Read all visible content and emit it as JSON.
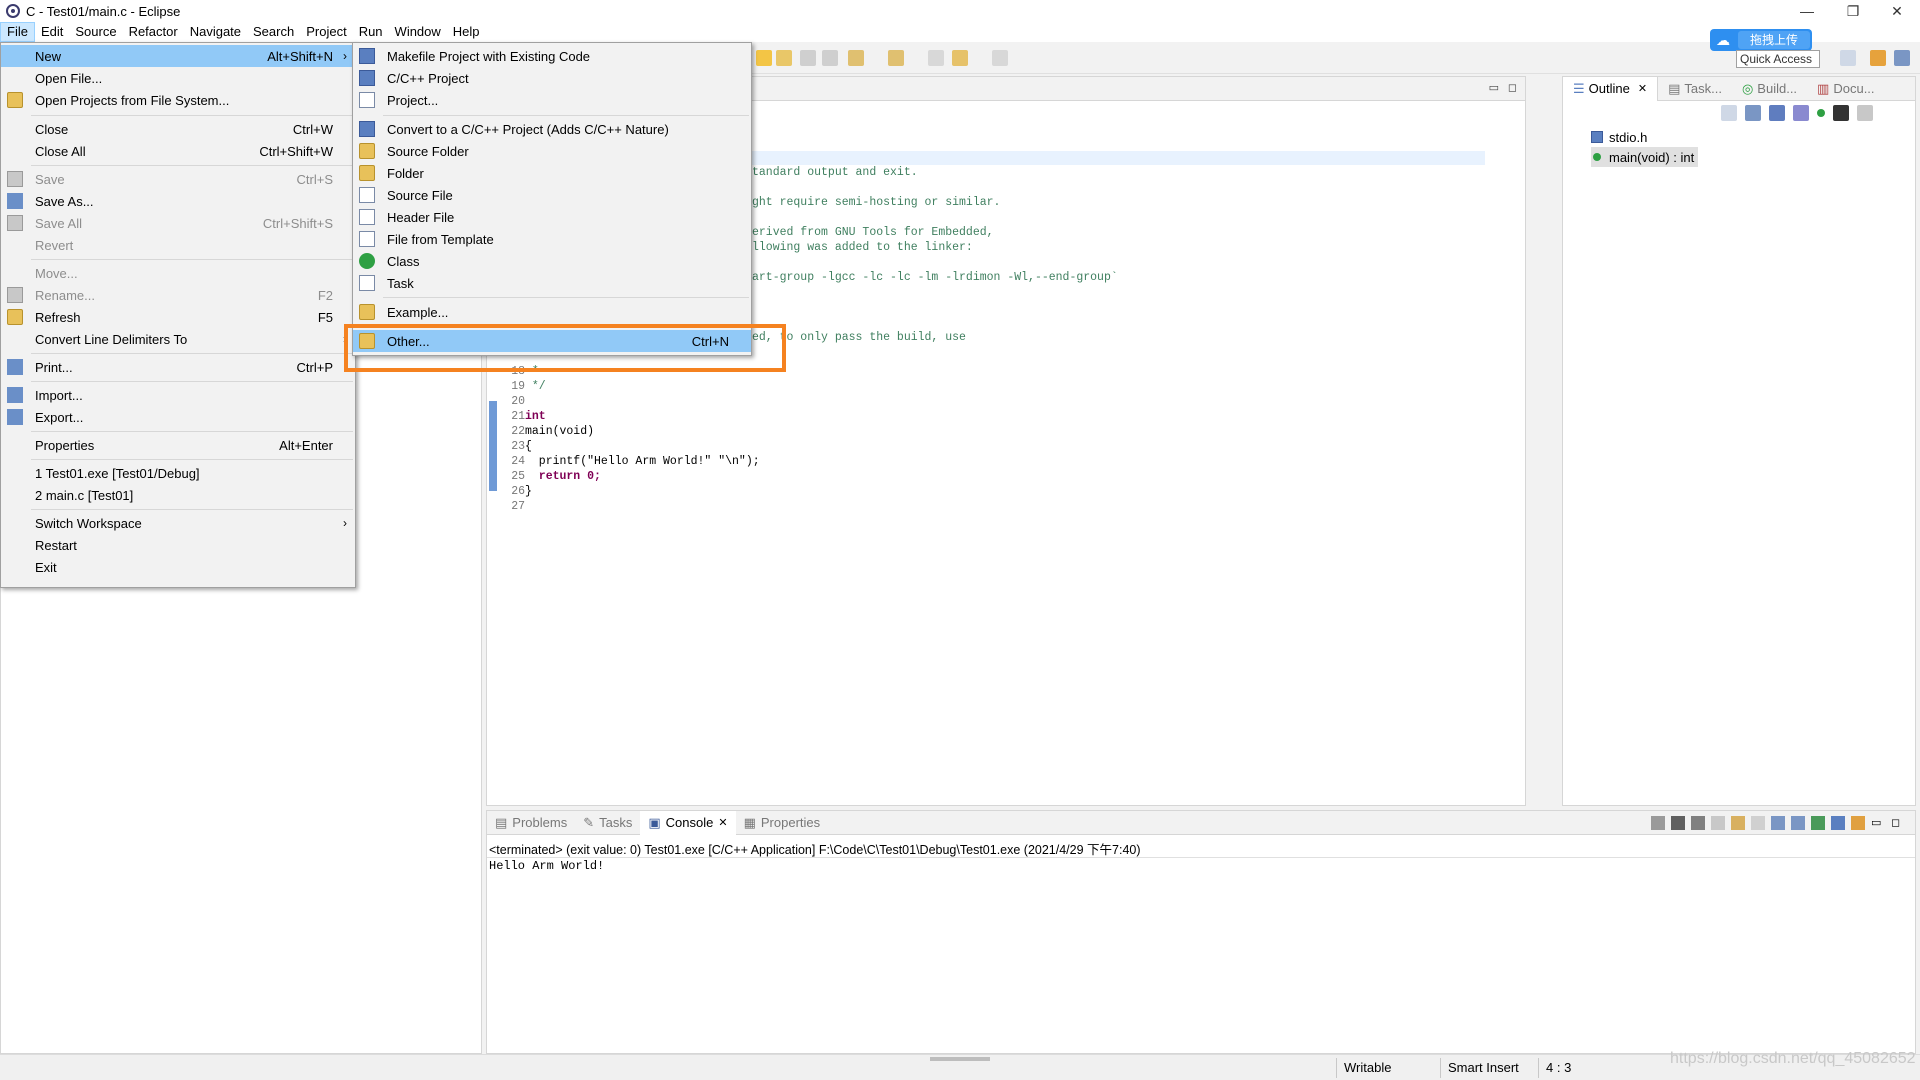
{
  "window": {
    "title": "C - Test01/main.c - Eclipse",
    "controls": [
      "—",
      "❐",
      "✕"
    ]
  },
  "menubar": [
    "File",
    "Edit",
    "Source",
    "Refactor",
    "Navigate",
    "Search",
    "Project",
    "Run",
    "Window",
    "Help"
  ],
  "toolbar": {
    "quick_access": "Quick Access",
    "upload_badge": "拖拽上传"
  },
  "file_menu": [
    {
      "label": "New",
      "accel": "Alt+Shift+N",
      "submenu": true,
      "highlighted": true
    },
    {
      "label": "Open File...",
      "accel": ""
    },
    {
      "label": "Open Projects from File System...",
      "accel": ""
    },
    {
      "label": "Close",
      "accel": "Ctrl+W"
    },
    {
      "label": "Close All",
      "accel": "Ctrl+Shift+W"
    },
    {
      "label": "Save",
      "accel": "Ctrl+S",
      "disabled": true
    },
    {
      "label": "Save As...",
      "accel": ""
    },
    {
      "label": "Save All",
      "accel": "Ctrl+Shift+S",
      "disabled": true
    },
    {
      "label": "Revert",
      "accel": "",
      "disabled": true
    },
    {
      "label": "Move...",
      "accel": "",
      "disabled": true
    },
    {
      "label": "Rename...",
      "accel": "F2",
      "disabled": true
    },
    {
      "label": "Refresh",
      "accel": "F5"
    },
    {
      "label": "Convert Line Delimiters To",
      "accel": "",
      "submenu": true
    },
    {
      "label": "Print...",
      "accel": "Ctrl+P"
    },
    {
      "label": "Import...",
      "accel": ""
    },
    {
      "label": "Export...",
      "accel": ""
    },
    {
      "label": "Properties",
      "accel": "Alt+Enter"
    },
    {
      "label": "1 Test01.exe  [Test01/Debug]",
      "accel": ""
    },
    {
      "label": "2 main.c  [Test01]",
      "accel": ""
    },
    {
      "label": "Switch Workspace",
      "accel": "",
      "submenu": true
    },
    {
      "label": "Restart",
      "accel": ""
    },
    {
      "label": "Exit",
      "accel": ""
    }
  ],
  "new_submenu": [
    {
      "label": "Makefile Project with Existing Code",
      "icon": "makefile-project-icon"
    },
    {
      "label": "C/C++ Project",
      "icon": "c-project-icon"
    },
    {
      "label": "Project...",
      "icon": "project-icon"
    },
    {
      "label": "Convert to a C/C++ Project (Adds C/C++ Nature)",
      "icon": "convert-icon"
    },
    {
      "label": "Source Folder",
      "icon": "source-folder-icon"
    },
    {
      "label": "Folder",
      "icon": "folder-icon"
    },
    {
      "label": "Source File",
      "icon": "source-file-icon"
    },
    {
      "label": "Header File",
      "icon": "header-file-icon"
    },
    {
      "label": "File from Template",
      "icon": "template-file-icon"
    },
    {
      "label": "Class",
      "icon": "class-icon"
    },
    {
      "label": "Task",
      "icon": "task-icon"
    },
    {
      "label": "Example...",
      "icon": "example-icon"
    },
    {
      "label": "Other...",
      "accel": "Ctrl+N",
      "icon": "other-wizard-icon",
      "highlighted": true
    }
  ],
  "editor": {
    "visible_fragments": [
      "tandard output and exit.",
      "ght require semi-hosting or similar.",
      "erived from GNU Tools for Embedded,",
      "llowing was added to the linker:",
      "art-group -lgcc -lc -lc -lm -lrdimon -Wl,--end-group`",
      "ed, to only pass the build, use"
    ],
    "code_lines": [
      {
        "num": "18",
        "text": " *"
      },
      {
        "num": "19",
        "text": " */"
      },
      {
        "num": "20",
        "text": ""
      },
      {
        "num": "21",
        "text": "int"
      },
      {
        "num": "22",
        "text": "main(void)"
      },
      {
        "num": "23",
        "text": "{"
      },
      {
        "num": "24",
        "text": "  printf(\"Hello Arm World!\" \"\\n\");"
      },
      {
        "num": "25",
        "text": "  return 0;"
      },
      {
        "num": "26",
        "text": "}"
      },
      {
        "num": "27",
        "text": ""
      }
    ]
  },
  "outline": {
    "tabs": [
      "Outline",
      "Task...",
      "Build...",
      "Docu..."
    ],
    "items": [
      "stdio.h",
      "main(void) : int"
    ]
  },
  "console": {
    "tabs": [
      "Problems",
      "Tasks",
      "Console",
      "Properties"
    ],
    "header": "<terminated> (exit value: 0) Test01.exe [C/C++ Application] F:\\Code\\C\\Test01\\Debug\\Test01.exe (2021/4/29 下午7:40)",
    "output": "Hello Arm World!"
  },
  "statusbar": {
    "writable": "Writable",
    "insert_mode": "Smart Insert",
    "position": "4 : 3"
  },
  "watermark": "https://blog.csdn.net/qq_45082652"
}
